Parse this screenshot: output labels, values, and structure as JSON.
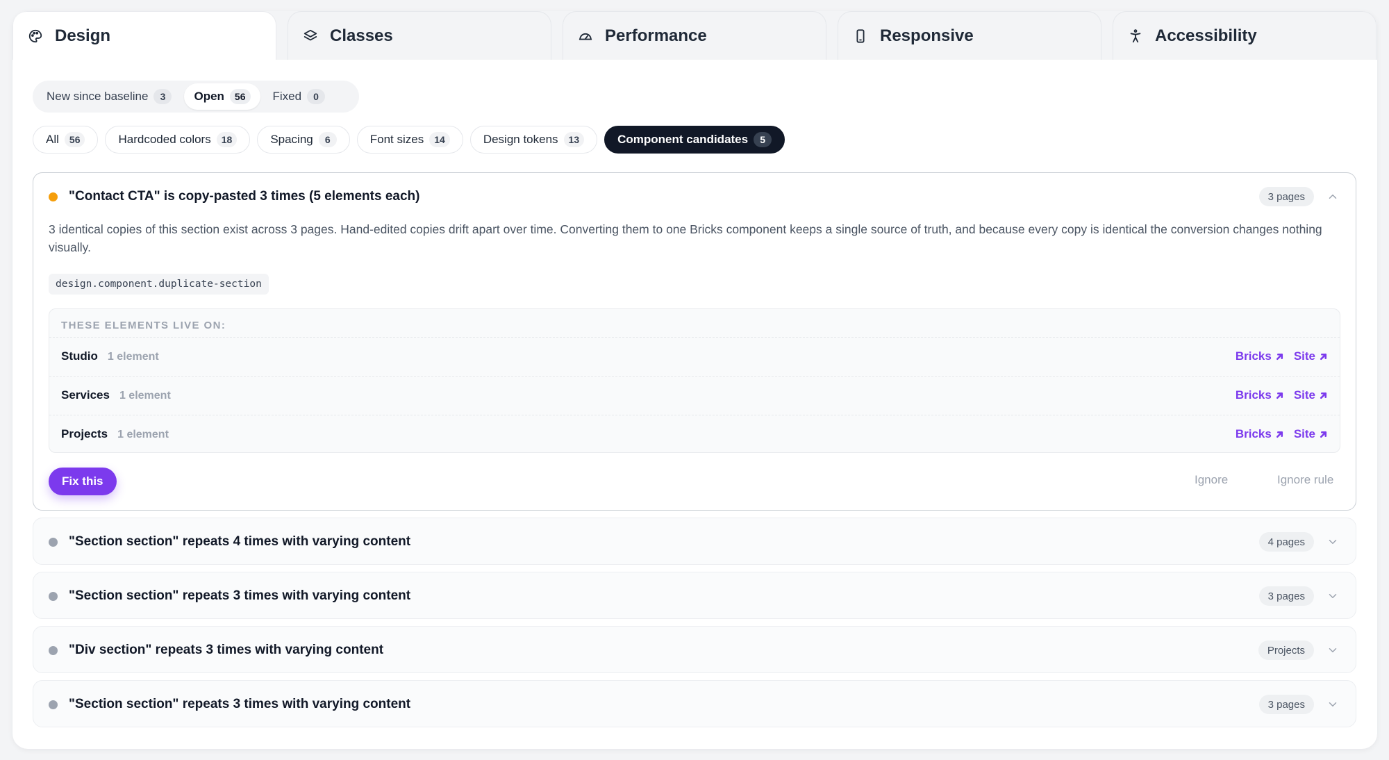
{
  "tabs": [
    {
      "label": "Design",
      "icon": "palette-icon"
    },
    {
      "label": "Classes",
      "icon": "layers-icon"
    },
    {
      "label": "Performance",
      "icon": "gauge-icon"
    },
    {
      "label": "Responsive",
      "icon": "smartphone-icon"
    },
    {
      "label": "Accessibility",
      "icon": "accessibility-icon"
    }
  ],
  "status_filter": {
    "items": [
      {
        "label": "New since baseline",
        "count": "3"
      },
      {
        "label": "Open",
        "count": "56"
      },
      {
        "label": "Fixed",
        "count": "0"
      }
    ],
    "active": "Open"
  },
  "category_filter": {
    "items": [
      {
        "label": "All",
        "count": "56"
      },
      {
        "label": "Hardcoded colors",
        "count": "18"
      },
      {
        "label": "Spacing",
        "count": "6"
      },
      {
        "label": "Font sizes",
        "count": "14"
      },
      {
        "label": "Design tokens",
        "count": "13"
      },
      {
        "label": "Component candidates",
        "count": "5"
      }
    ],
    "active": "Component candidates"
  },
  "issues": [
    {
      "title": "\"Contact CTA\" is copy-pasted 3 times (5 elements each)",
      "badge": "3 pages",
      "severity_color": "#f59e0b",
      "expanded": true,
      "description": "3 identical copies of this section exist across 3 pages. Hand-edited copies drift apart over time. Converting them to one Bricks component keeps a single source of truth, and because every copy is identical the conversion changes nothing visually.",
      "rule_id": "design.component.duplicate-section",
      "pages_heading": "THESE ELEMENTS LIVE ON:",
      "pages": [
        {
          "name": "Studio",
          "count": "1 element",
          "link1": "Bricks",
          "link2": "Site"
        },
        {
          "name": "Services",
          "count": "1 element",
          "link1": "Bricks",
          "link2": "Site"
        },
        {
          "name": "Projects",
          "count": "1 element",
          "link1": "Bricks",
          "link2": "Site"
        }
      ],
      "actions": {
        "fix": "Fix this",
        "ignore": "Ignore",
        "ignore_rule": "Ignore rule"
      }
    },
    {
      "title": "\"Section section\" repeats 4 times with varying content",
      "badge": "4 pages",
      "severity_color": "#9ca3af"
    },
    {
      "title": "\"Section section\" repeats 3 times with varying content",
      "badge": "3 pages",
      "severity_color": "#9ca3af"
    },
    {
      "title": "\"Div section\" repeats 3 times with varying content",
      "badge": "Projects",
      "severity_color": "#9ca3af"
    },
    {
      "title": "\"Section section\" repeats 3 times with varying content",
      "badge": "3 pages",
      "severity_color": "#9ca3af"
    }
  ],
  "colors": {
    "accent": "#7c3aed",
    "active_chip": "#111827"
  }
}
